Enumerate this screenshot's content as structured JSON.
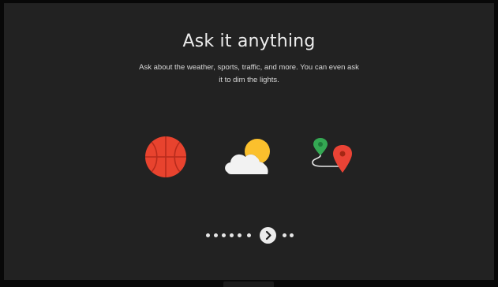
{
  "onboarding": {
    "title": "Ask it anything",
    "subtitle": "Ask about the weather, sports, traffic, and more. You can even ask it to dim the lights."
  },
  "illustrations": [
    {
      "name": "basketball-icon"
    },
    {
      "name": "weather-icon"
    },
    {
      "name": "map-directions-icon"
    }
  ],
  "pager": {
    "dots_before": 6,
    "dots_after": 2,
    "next_icon": "chevron-right-icon"
  },
  "colors": {
    "screen_background": "#222222",
    "basketball": "#e8432e",
    "sun": "#fbc02d",
    "cloud": "#f2f2f2",
    "map_pin_green": "#34a853",
    "map_pin_red": "#ea4335"
  }
}
